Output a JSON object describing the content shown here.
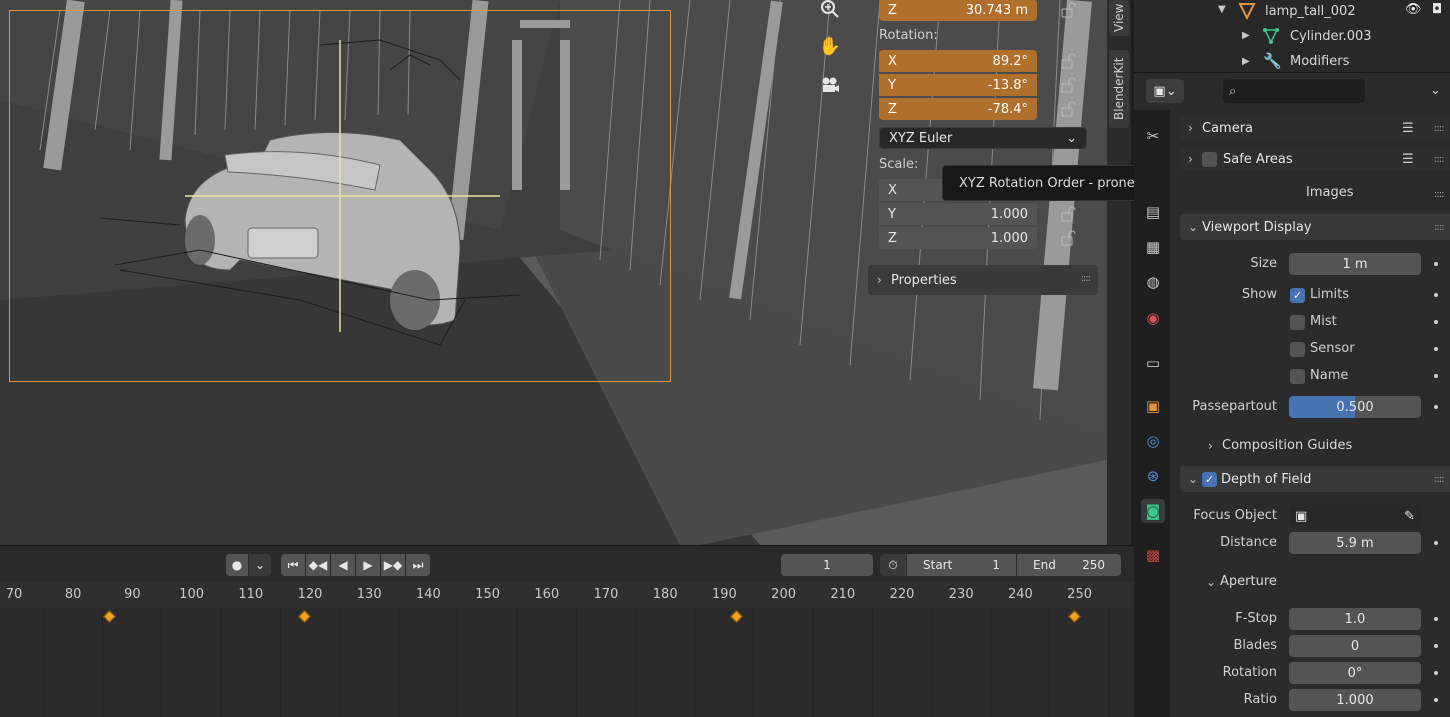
{
  "npanel": {
    "location_z_label": "Z",
    "location_z_value": "30.743 m",
    "rotation_label": "Rotation:",
    "rotation": [
      {
        "axis": "X",
        "value": "89.2°"
      },
      {
        "axis": "Y",
        "value": "-13.8°"
      },
      {
        "axis": "Z",
        "value": "-78.4°"
      }
    ],
    "rotation_mode": "XYZ Euler",
    "scale_label": "Scale:",
    "scale": [
      {
        "axis": "X",
        "value": ""
      },
      {
        "axis": "Y",
        "value": "1.000"
      },
      {
        "axis": "Z",
        "value": "1.000"
      }
    ],
    "properties_label": "Properties"
  },
  "side_tabs": [
    "View",
    "BlenderKit"
  ],
  "tooltip": "XYZ Rotation Order - prone to Gimbal Lock (default)",
  "timeline": {
    "current_frame": "1",
    "start_label": "Start",
    "start_value": "1",
    "end_label": "End",
    "end_value": "250",
    "ruler": [
      "70",
      "80",
      "90",
      "100",
      "110",
      "120",
      "130",
      "140",
      "150",
      "160",
      "170",
      "180",
      "190",
      "200",
      "210",
      "220",
      "230",
      "240",
      "250"
    ],
    "keyframes": [
      86,
      119,
      192,
      249
    ]
  },
  "outliner": {
    "items": [
      {
        "name": "lamp_tall_002",
        "icon": "mesh-object-icon"
      },
      {
        "name": "Cylinder.003",
        "icon": "mesh-data-icon"
      },
      {
        "name": "Modifiers",
        "icon": "wrench-icon"
      }
    ]
  },
  "properties": {
    "search_placeholder": "",
    "panels": {
      "camera": "Camera",
      "safe_areas": "Safe Areas",
      "background_images": "Images",
      "viewport_display": "Viewport Display",
      "composition_guides": "Composition Guides",
      "depth_of_field": "Depth of Field",
      "aperture": "Aperture"
    },
    "size_label": "Size",
    "size_value": "1 m",
    "show_label": "Show",
    "show_options": [
      {
        "label": "Limits",
        "checked": true
      },
      {
        "label": "Mist",
        "checked": false
      },
      {
        "label": "Sensor",
        "checked": false
      },
      {
        "label": "Name",
        "checked": false
      }
    ],
    "passepartout_label": "Passepartout",
    "passepartout_value": "0.500",
    "passepartout_fraction": 0.5,
    "focus_object_label": "Focus Object",
    "distance_label": "Distance",
    "distance_value": "5.9 m",
    "fstop_label": "F-Stop",
    "fstop_value": "1.0",
    "blades_label": "Blades",
    "blades_value": "0",
    "rotation_label": "Rotation",
    "rotation_value": "0°",
    "ratio_label": "Ratio",
    "ratio_value": "1.000"
  },
  "colors": {
    "accent_orange": "#b06f2b",
    "keyframe": "#f0a020",
    "checkbox_blue": "#4772b3",
    "camera_frame": "#e0953a"
  }
}
